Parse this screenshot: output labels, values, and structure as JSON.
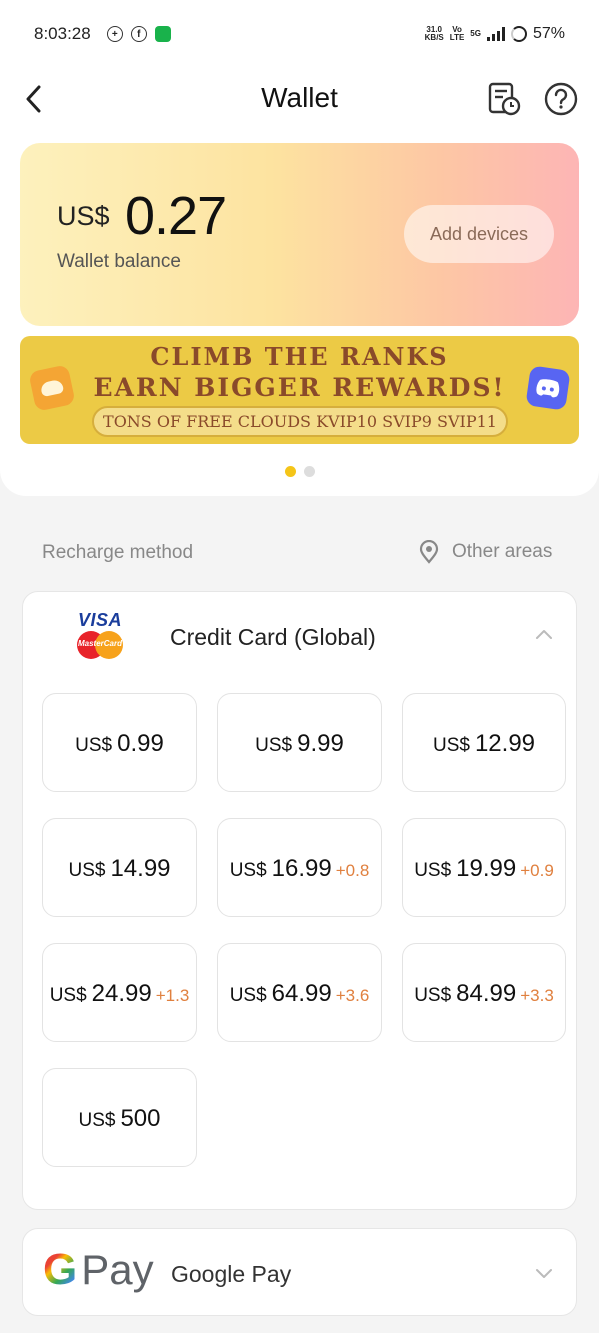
{
  "status_bar": {
    "time": "8:03:28",
    "net_speed_top": "31.0",
    "net_speed_unit": "KB/S",
    "volte_top": "Vo",
    "volte_bottom": "LTE",
    "network": "5G",
    "battery": "57%"
  },
  "header": {
    "title": "Wallet",
    "back_icon": "back-arrow",
    "history_icon": "billing-history",
    "help_icon": "question-mark"
  },
  "balance": {
    "currency": "US$",
    "amount": "0.27",
    "label": "Wallet balance",
    "add_devices_label": "Add devices"
  },
  "promo": {
    "line1": "CLIMB THE RANKS",
    "line2": "EARN BIGGER REWARDS!",
    "pill_text": "TONS OF FREE CLOUDS   KVIP10  SVIP9  SVIP11"
  },
  "carousel": {
    "total": 2,
    "active_index": 0
  },
  "recharge": {
    "label": "Recharge method",
    "other_areas": "Other areas"
  },
  "credit_card": {
    "logo_visa": "VISA",
    "logo_mastercard": "MasterCard",
    "title": "Credit Card (Global)",
    "expanded": true,
    "amounts": [
      {
        "currency": "US$",
        "value": "0.99",
        "bonus": ""
      },
      {
        "currency": "US$",
        "value": "9.99",
        "bonus": ""
      },
      {
        "currency": "US$",
        "value": "12.99",
        "bonus": ""
      },
      {
        "currency": "US$",
        "value": "14.99",
        "bonus": ""
      },
      {
        "currency": "US$",
        "value": "16.99",
        "bonus": "+0.8"
      },
      {
        "currency": "US$",
        "value": "19.99",
        "bonus": "+0.9"
      },
      {
        "currency": "US$",
        "value": "24.99",
        "bonus": "+1.3"
      },
      {
        "currency": "US$",
        "value": "64.99",
        "bonus": "+3.6"
      },
      {
        "currency": "US$",
        "value": "84.99",
        "bonus": "+3.3"
      },
      {
        "currency": "US$",
        "value": "500",
        "bonus": ""
      }
    ]
  },
  "google_pay": {
    "logo_g": "G",
    "logo_pay": "Pay",
    "label": "Google Pay",
    "expanded": false
  },
  "colors": {
    "accent_yellow": "#f5c518",
    "bonus_orange": "#e0803f",
    "promo_bg": "#ecca45"
  }
}
